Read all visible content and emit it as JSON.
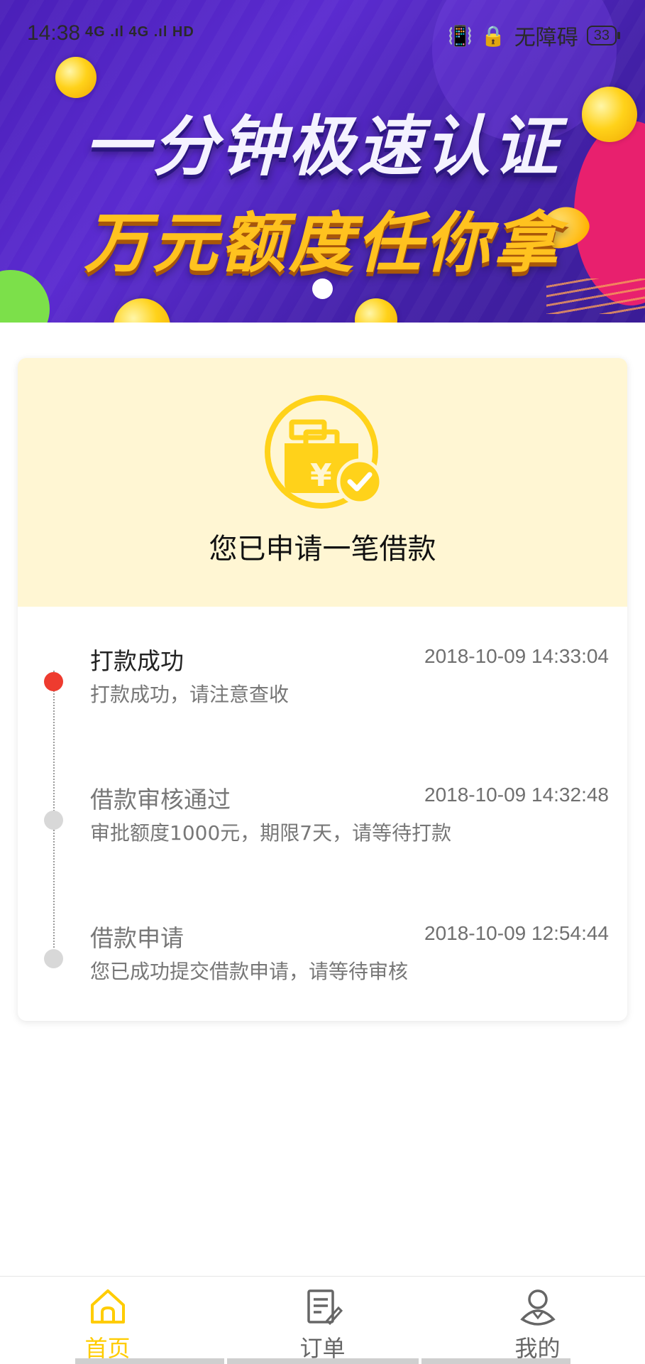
{
  "status_bar": {
    "time": "14:38",
    "signal": "4G .ıl 4G .ıl HD",
    "accessibility": "无障碍",
    "battery": "33"
  },
  "banner": {
    "line1": "一分钟极速认证",
    "line2": "万元额度任你拿"
  },
  "card": {
    "title": "您已申请一笔借款"
  },
  "timeline": [
    {
      "title": "打款成功",
      "time": "2018-10-09 14:33:04",
      "desc": "打款成功，请注意查收",
      "active": true
    },
    {
      "title": "借款审核通过",
      "time": "2018-10-09 14:32:48",
      "desc": "审批额度1000元，期限7天，请等待打款",
      "active": false
    },
    {
      "title": "借款申请",
      "time": "2018-10-09 12:54:44",
      "desc": "您已成功提交借款申请，请等待审核",
      "active": false
    }
  ],
  "nav": {
    "home": "首页",
    "orders": "订单",
    "mine": "我的"
  },
  "colors": {
    "accent": "#ffd21a",
    "active_dot": "#ee3b2f",
    "inactive_dot": "#d8d8d8",
    "header_bg": "#fff6d3"
  }
}
